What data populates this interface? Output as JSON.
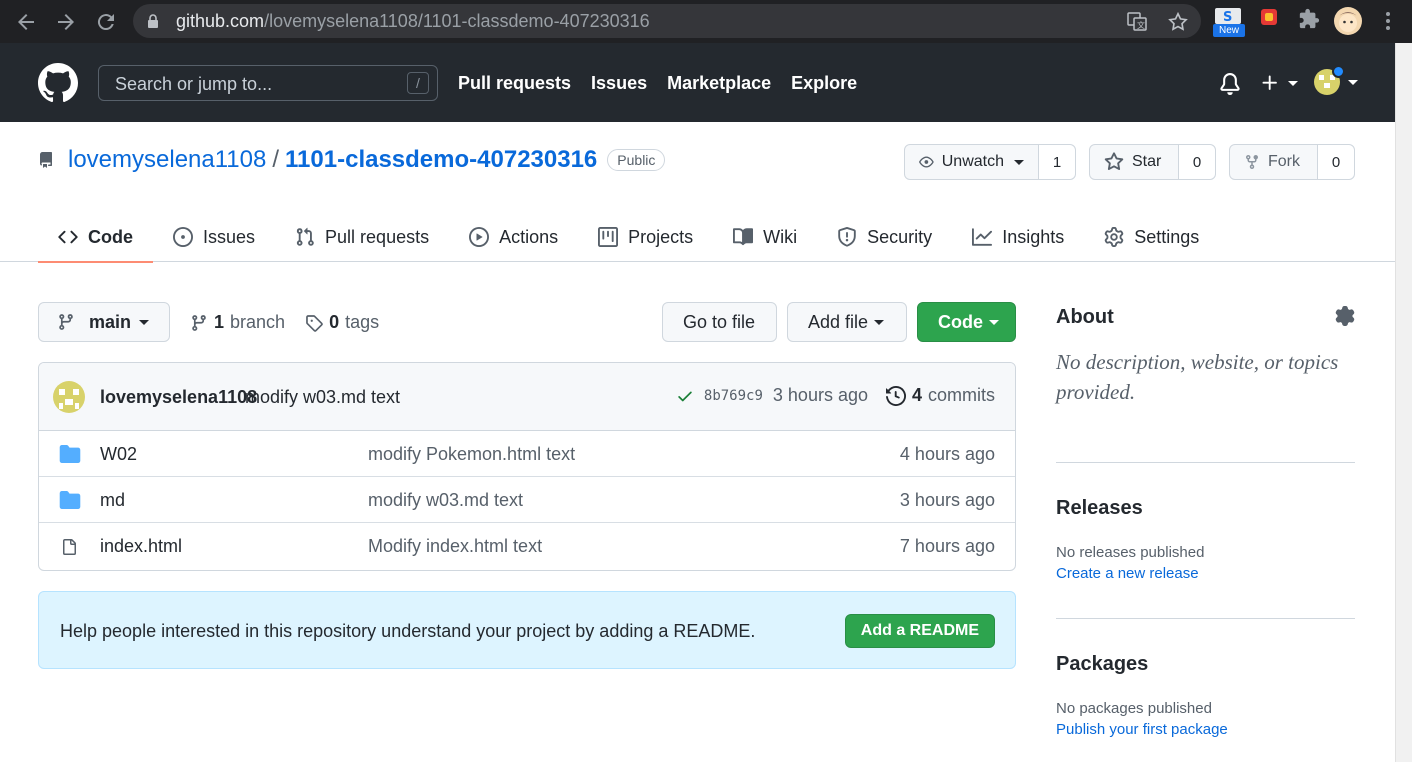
{
  "browser": {
    "url_host": "github.com",
    "url_path": "/lovemyselena1108/1101-classdemo-407230316",
    "new_badge": "New"
  },
  "header": {
    "search_placeholder": "Search or jump to...",
    "search_shortcut": "/",
    "nav": [
      "Pull requests",
      "Issues",
      "Marketplace",
      "Explore"
    ]
  },
  "repo": {
    "owner": "lovemyselena1108",
    "separator": "/",
    "name": "1101-classdemo-407230316",
    "visibility": "Public",
    "watch_label": "Unwatch",
    "watch_count": "1",
    "star_label": "Star",
    "star_count": "0",
    "fork_label": "Fork",
    "fork_count": "0"
  },
  "tabs": [
    {
      "label": "Code",
      "icon": "code-icon"
    },
    {
      "label": "Issues",
      "icon": "issue-icon"
    },
    {
      "label": "Pull requests",
      "icon": "pull-request-icon"
    },
    {
      "label": "Actions",
      "icon": "play-icon"
    },
    {
      "label": "Projects",
      "icon": "project-icon"
    },
    {
      "label": "Wiki",
      "icon": "book-icon"
    },
    {
      "label": "Security",
      "icon": "shield-icon"
    },
    {
      "label": "Insights",
      "icon": "graph-icon"
    },
    {
      "label": "Settings",
      "icon": "gear-icon"
    }
  ],
  "toolbar": {
    "branch": "main",
    "branch_count": "1",
    "branch_label": "branch",
    "tag_count": "0",
    "tag_label": "tags",
    "goto_file": "Go to file",
    "add_file": "Add file",
    "code": "Code"
  },
  "commit": {
    "author": "lovemyselena1108",
    "message": "modify w03.md text",
    "sha": "8b769c9",
    "age": "3 hours ago",
    "count": "4",
    "count_label": "commits"
  },
  "files": [
    {
      "name": "W02",
      "type": "folder",
      "message": "modify Pokemon.html text",
      "age": "4 hours ago"
    },
    {
      "name": "md",
      "type": "folder",
      "message": "modify w03.md text",
      "age": "3 hours ago"
    },
    {
      "name": "index.html",
      "type": "file",
      "message": "Modify index.html text",
      "age": "7 hours ago"
    }
  ],
  "readme": {
    "text": "Help people interested in this repository understand your project by adding a README.",
    "button": "Add a README"
  },
  "sidebar": {
    "about_title": "About",
    "about_desc": "No description, website, or topics provided.",
    "releases_title": "Releases",
    "releases_text": "No releases published",
    "releases_link": "Create a new release",
    "packages_title": "Packages",
    "packages_text": "No packages published",
    "packages_link": "Publish your first package"
  }
}
